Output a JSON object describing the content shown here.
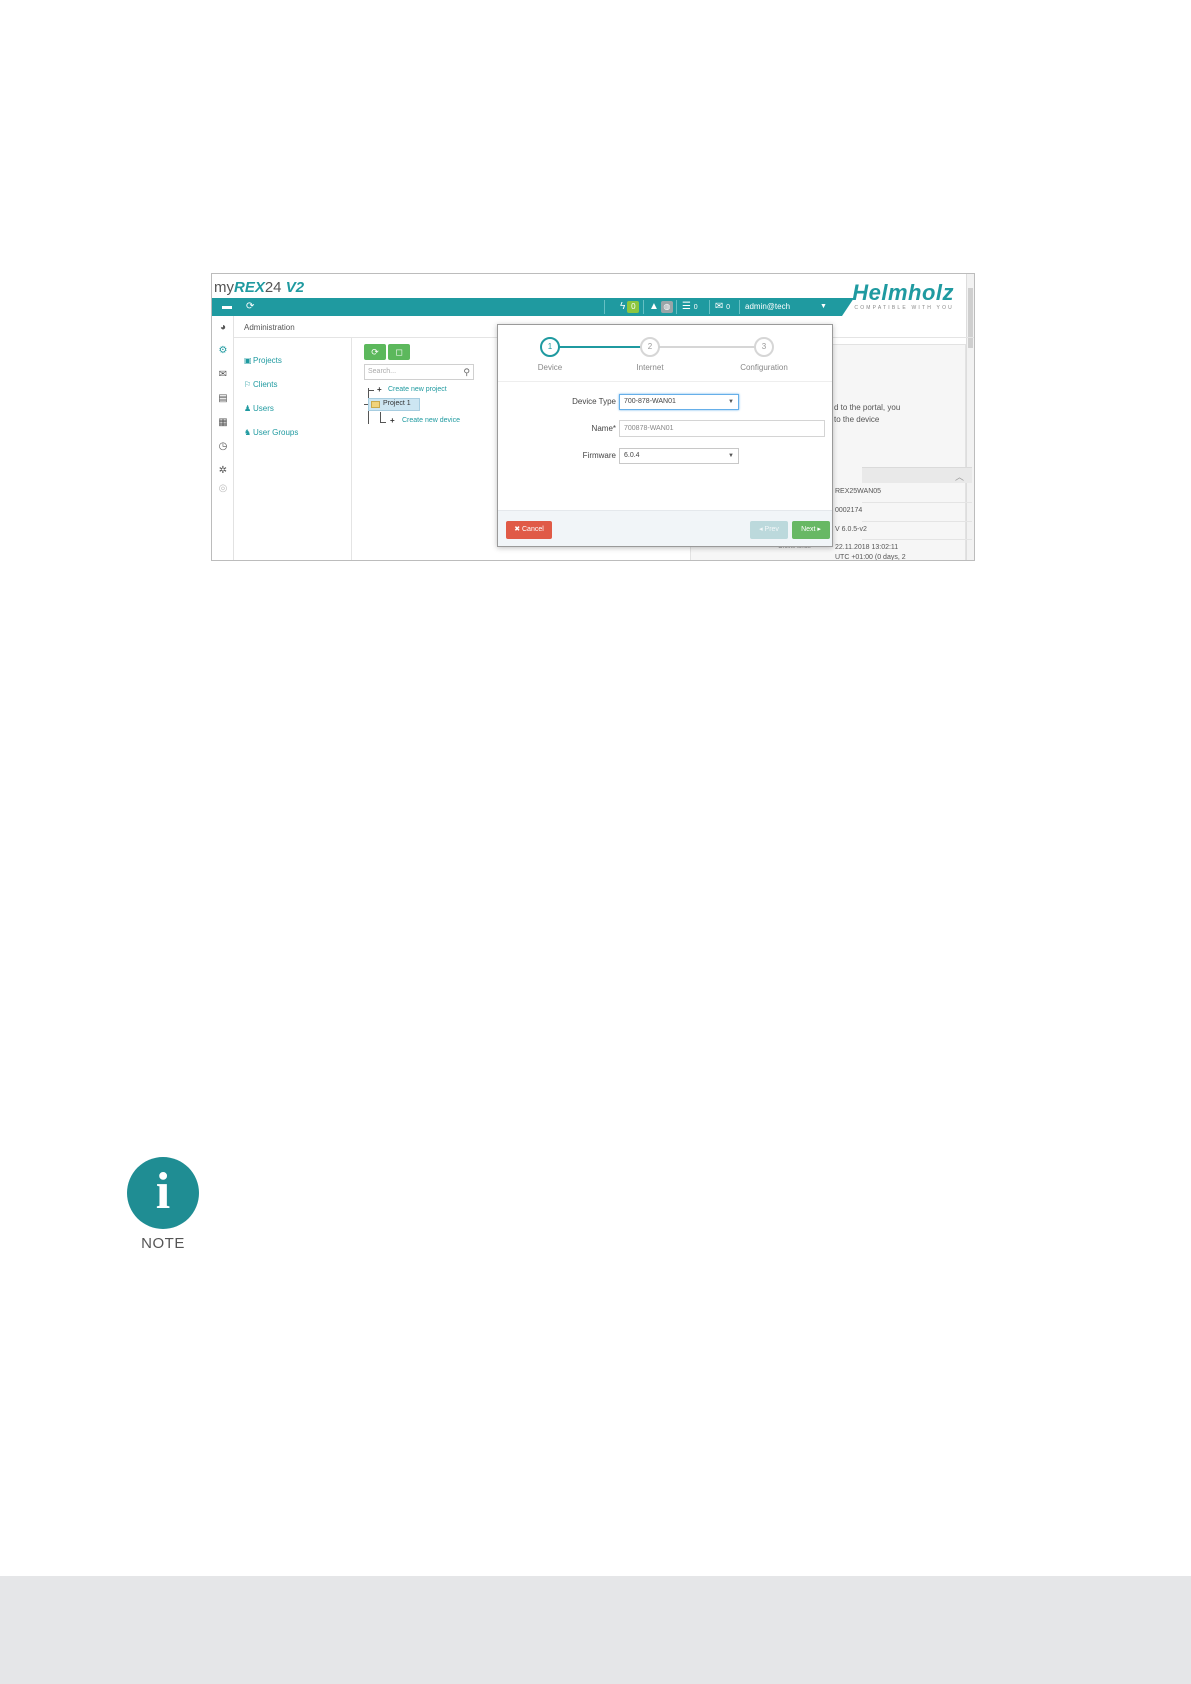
{
  "screenshot": {
    "app_title": {
      "prefix": "my",
      "brand": "REX",
      "suffix": "24",
      "version": "V2"
    },
    "logo": {
      "name": "Helmholz",
      "tagline": "COMPATIBLE WITH YOU"
    },
    "topbar": {
      "bolt_count": "0",
      "list_count": "0",
      "mail_count": "0",
      "user": "admin@tech"
    },
    "breadcrumb": "Administration",
    "menu": [
      "Projects",
      "Clients",
      "Users",
      "User Groups"
    ],
    "tree": {
      "search_placeholder": "Search...",
      "create_project": "Create new project",
      "project": "Project 1",
      "create_device": "Create new device"
    },
    "background": {
      "line1": "d to the portal, you",
      "line2": "to the device",
      "row1": "REX25WAN05",
      "row2": "0002174",
      "row3": "V 6.0.5-v2",
      "label4": "Online since",
      "row4a": "22.11.2018 13:02:11",
      "row4b": "UTC +01:00 (0 days, 2"
    },
    "wizard": {
      "steps": [
        {
          "number": "1",
          "label": "Device"
        },
        {
          "number": "2",
          "label": "Internet"
        },
        {
          "number": "3",
          "label": "Configuration"
        }
      ],
      "fields": {
        "device_type_label": "Device Type",
        "device_type_value": "700-878-WAN01",
        "name_label": "Name*",
        "name_value": "700878-WAN01",
        "firmware_label": "Firmware",
        "firmware_value": "6.0.4"
      },
      "buttons": {
        "cancel": "✖ Cancel",
        "prev": "◂ Prev",
        "next": "Next ▸"
      }
    }
  },
  "note": {
    "label": "NOTE"
  },
  "colors": {
    "accent": "#1f9aa0",
    "cancel": "#e05a47",
    "next": "#68b864",
    "footer": "#e5e6e8"
  }
}
